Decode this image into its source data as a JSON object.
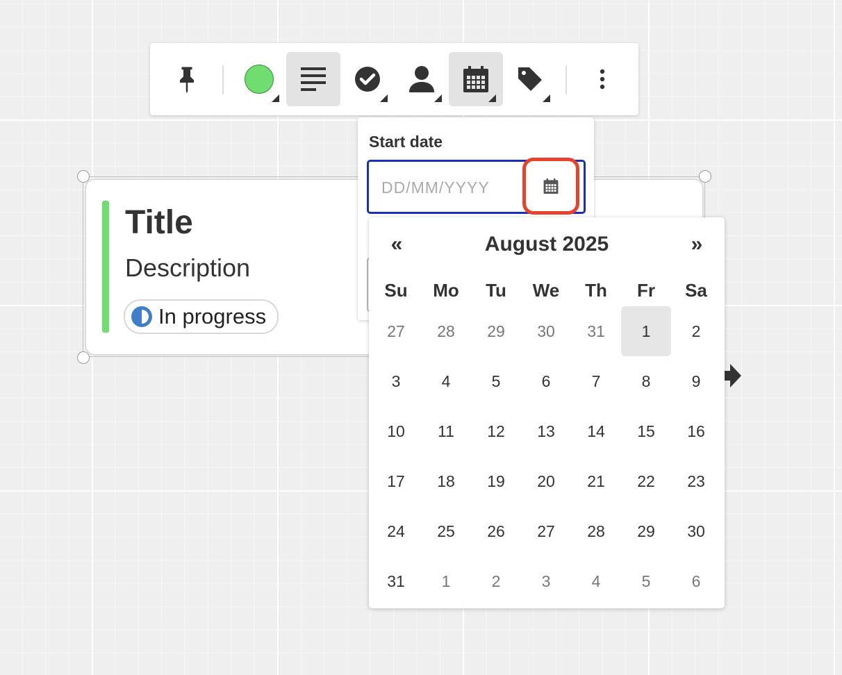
{
  "toolbar": {
    "buttons": [
      {
        "id": "pin",
        "icon": "pushpin-icon"
      },
      {
        "id": "color",
        "icon": "color-swatch",
        "color": "#6fdd6f"
      },
      {
        "id": "text",
        "icon": "text-align-icon",
        "active": true
      },
      {
        "id": "status",
        "icon": "check-circle-icon"
      },
      {
        "id": "assignee",
        "icon": "user-icon"
      },
      {
        "id": "date",
        "icon": "calendar-icon",
        "active": true
      },
      {
        "id": "tag",
        "icon": "tag-icon"
      },
      {
        "id": "more",
        "icon": "more-vertical-icon"
      }
    ]
  },
  "card": {
    "title": "Title",
    "description": "Description",
    "status": "In progress",
    "accent_color": "#6fdd6f"
  },
  "date_panel": {
    "label": "Start date",
    "input_value": "",
    "input_placeholder": "DD/MM/YYYY"
  },
  "calendar": {
    "month_label": "August 2025",
    "prev": "«",
    "next": "»",
    "weekdays": [
      "Su",
      "Mo",
      "Tu",
      "We",
      "Th",
      "Fr",
      "Sa"
    ],
    "weeks": [
      [
        {
          "d": "27",
          "m": true
        },
        {
          "d": "28",
          "m": true
        },
        {
          "d": "29",
          "m": true
        },
        {
          "d": "30",
          "m": true
        },
        {
          "d": "31",
          "m": true
        },
        {
          "d": "1",
          "t": true
        },
        {
          "d": "2"
        }
      ],
      [
        {
          "d": "3"
        },
        {
          "d": "4"
        },
        {
          "d": "5"
        },
        {
          "d": "6"
        },
        {
          "d": "7"
        },
        {
          "d": "8"
        },
        {
          "d": "9"
        }
      ],
      [
        {
          "d": "10"
        },
        {
          "d": "11"
        },
        {
          "d": "12"
        },
        {
          "d": "13"
        },
        {
          "d": "14"
        },
        {
          "d": "15"
        },
        {
          "d": "16"
        }
      ],
      [
        {
          "d": "17"
        },
        {
          "d": "18"
        },
        {
          "d": "19"
        },
        {
          "d": "20"
        },
        {
          "d": "21"
        },
        {
          "d": "22"
        },
        {
          "d": "23"
        }
      ],
      [
        {
          "d": "24"
        },
        {
          "d": "25"
        },
        {
          "d": "26"
        },
        {
          "d": "27"
        },
        {
          "d": "28"
        },
        {
          "d": "29"
        },
        {
          "d": "30"
        }
      ],
      [
        {
          "d": "31"
        },
        {
          "d": "1",
          "m": true
        },
        {
          "d": "2",
          "m": true
        },
        {
          "d": "3",
          "m": true
        },
        {
          "d": "4",
          "m": true
        },
        {
          "d": "5",
          "m": true
        },
        {
          "d": "6",
          "m": true
        }
      ]
    ]
  },
  "colors": {
    "accent_green": "#6fdd6f",
    "focus_blue": "#1a2fb8",
    "highlight_red": "#e8412c",
    "status_blue": "#3d7fc9"
  }
}
